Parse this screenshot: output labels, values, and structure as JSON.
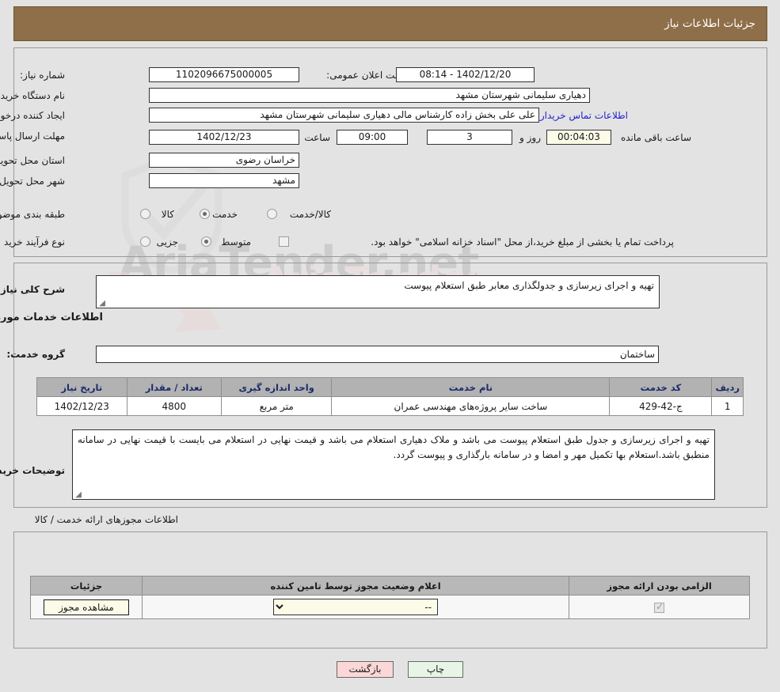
{
  "header": {
    "title": "جزئیات اطلاعات نیاز",
    "bg_color": "#8e6f49",
    "text_color": "#ffffff"
  },
  "watermark": {
    "text": "AriaTender.net",
    "text2": "AriaTender"
  },
  "top_panel": {
    "need_number_label": "شماره نیاز:",
    "need_number_value": "1102096675000005",
    "public_announce_label": "تاریخ و ساعت اعلان عمومی:",
    "public_announce_value": "1402/12/20 - 08:14",
    "buyer_org_label": "نام دستگاه خریدار:",
    "buyer_org_value": "دهیاری سلیمانی  شهرستان مشهد",
    "requester_label": "ایجاد کننده درخواست:",
    "requester_value": "علی علی بخش زاده کارشناس مالی دهیاری سلیمانی  شهرستان مشهد",
    "contact_link": "اطلاعات تماس خریدار",
    "deadline_label": "مهلت ارسال پاسخ: تا تاریخ:",
    "deadline_date": "1402/12/23",
    "hour_label": "ساعت",
    "deadline_time": "09:00",
    "days_value": "3",
    "days_label": "روز و",
    "countdown_value": "00:04:03",
    "remaining_label": "ساعت باقی مانده",
    "province_label": "استان محل تحویل:",
    "province_value": "خراسان رضوی",
    "city_label": "شهر محل تحویل:",
    "city_value": "مشهد",
    "category_label": "طبقه بندی موضوعی:",
    "category_options": [
      {
        "label": "کالا",
        "selected": false
      },
      {
        "label": "خدمت",
        "selected": true
      },
      {
        "label": "کالا/خدمت",
        "selected": false
      }
    ],
    "process_label": "نوع فرآیند خرید :",
    "process_options": [
      {
        "label": "جزیی",
        "selected": false
      },
      {
        "label": "متوسط",
        "selected": true
      }
    ],
    "treasury_checkbox_label": "پرداخت تمام یا بخشی از مبلغ خرید،از محل \"اسناد خزانه اسلامی\" خواهد بود.",
    "treasury_checked": false
  },
  "mid_panel": {
    "general_desc_label": "شرح کلی نیاز:",
    "general_desc_value": "تهیه و اجرای زیرسازی و جدولگذاری معابر طبق استعلام پیوست",
    "services_info_heading": "اطلاعات خدمات مورد نیاز",
    "service_group_label": "گروه خدمت:",
    "service_group_value": "ساختمان",
    "table": {
      "headers": [
        "ردیف",
        "کد خدمت",
        "نام خدمت",
        "واحد اندازه گیری",
        "تعداد / مقدار",
        "تاریخ نیاز"
      ],
      "rows": [
        {
          "row": "1",
          "code": "ج-42-429",
          "name": "ساخت سایر پروژه‌های مهندسی عمران",
          "unit": "متر مربع",
          "quantity": "4800",
          "date": "1402/12/23"
        }
      ]
    },
    "buyer_notes_label": "توضیحات خریدار:",
    "buyer_notes_value": "تهیه و اجرای زیرسازی و جدول طبق استعلام پیوست می باشد و ملاک دهیاری استعلام می باشد و قیمت نهایی در استعلام می بایست با قیمت نهایی در سامانه منطبق باشد.استعلام بها تکمیل مهر و امضا و در سامانه بارگذاری و پیوست گردد."
  },
  "permits": {
    "section_label": "اطلاعات مجوزهای ارائه خدمت / کالا",
    "headers": [
      "الزامی بودن ارائه مجوز",
      "اعلام وضعیت مجوز توسط تامین کننده",
      "جزئیات"
    ],
    "rows": [
      {
        "required_checked": true,
        "status_value": "--",
        "status_options": [
          "--"
        ],
        "details_button": "مشاهده مجوز"
      }
    ]
  },
  "footer": {
    "print_label": "چاپ",
    "back_label": "بازگشت",
    "print_color": "#e6f5e6",
    "back_color": "#fbd7d7"
  }
}
